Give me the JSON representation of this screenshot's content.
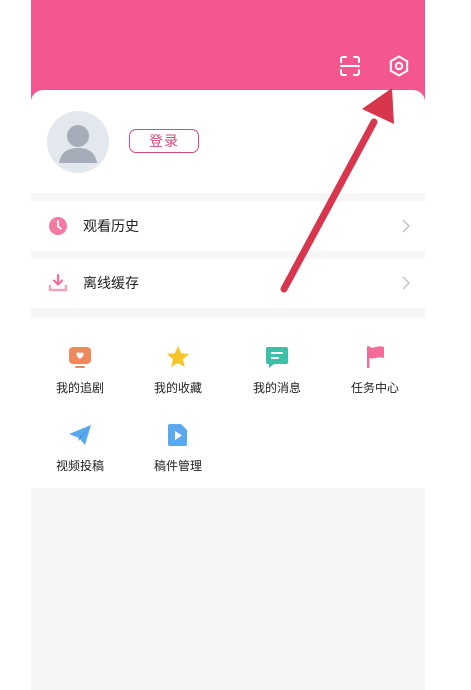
{
  "profile": {
    "login_label": "登录"
  },
  "menu_rows": [
    {
      "label": "观看历史"
    },
    {
      "label": "离线缓存"
    }
  ],
  "grid": [
    {
      "label": "我的追剧",
      "icon": "tv-icon",
      "color": "#f08a5d"
    },
    {
      "label": "我的收藏",
      "icon": "star-icon",
      "color": "#f7c42a"
    },
    {
      "label": "我的消息",
      "icon": "message-icon",
      "color": "#3cbfa7"
    },
    {
      "label": "任务中心",
      "icon": "flag-icon",
      "color": "#f26c9a"
    },
    {
      "label": "视频投稿",
      "icon": "paper-plane-icon",
      "color": "#5aa8ee"
    },
    {
      "label": "稿件管理",
      "icon": "video-file-icon",
      "color": "#5aa8ee"
    }
  ],
  "colors": {
    "header": "#f4568f",
    "accent": "#d64a82",
    "arrow": "#d8364c"
  }
}
